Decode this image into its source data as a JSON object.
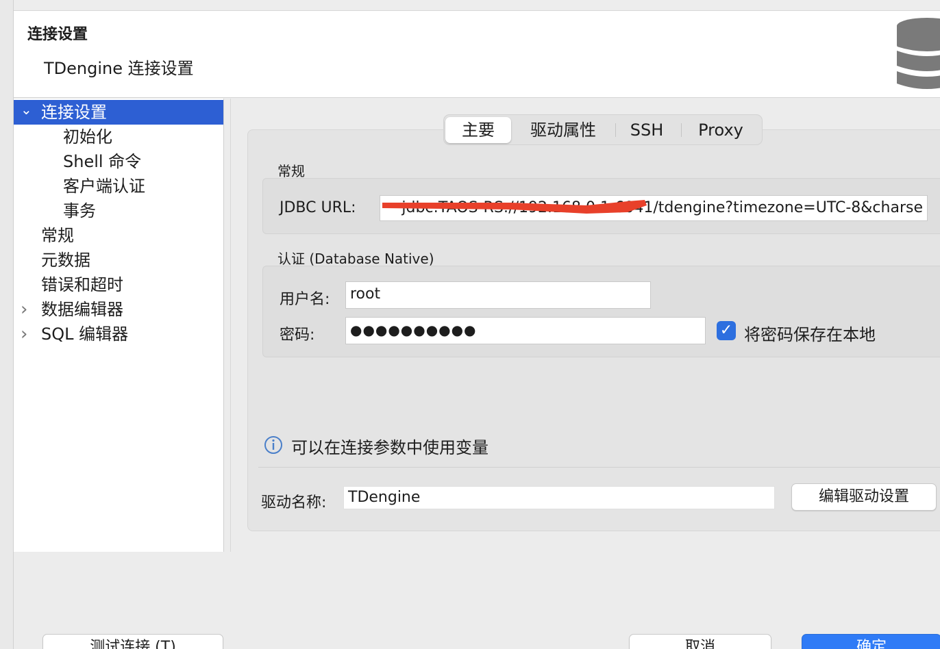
{
  "header": {
    "title": "连接设置",
    "subtitle": "TDengine 连接设置",
    "icon": "database-icon"
  },
  "nav": {
    "items": [
      {
        "label": "连接设置",
        "selected": true,
        "arrow": "⌄"
      },
      {
        "label": "初始化"
      },
      {
        "label": "Shell 命令"
      },
      {
        "label": "客户端认证"
      },
      {
        "label": "事务"
      },
      {
        "label": "常规"
      },
      {
        "label": "元数据"
      },
      {
        "label": "错误和超时"
      },
      {
        "label": "数据编辑器",
        "arrow": "›"
      },
      {
        "label": "SQL 编辑器",
        "arrow": "›"
      }
    ]
  },
  "tabs": [
    {
      "label": "主要",
      "active": true
    },
    {
      "label": "驱动属性"
    },
    {
      "label": "SSH"
    },
    {
      "label": "Proxy"
    }
  ],
  "general": {
    "label": "常规",
    "jdbc_label": "JDBC URL:",
    "jdbc_value": "jdbc:TAOS-RS://192.168.0.1:6041/tdengine?timezone=UTC-8&charse"
  },
  "auth": {
    "label": "认证 (Database Native)",
    "username_label": "用户名:",
    "username_value": "root",
    "password_label": "密码:",
    "password_value": "●●●●●●●●●●",
    "save_password_label": "将密码保存在本地",
    "save_password_checked": true
  },
  "info": {
    "text": "可以在连接参数中使用变量"
  },
  "driver": {
    "label": "驱动名称:",
    "value": "TDengine",
    "edit_button": "编辑驱动设置"
  },
  "footer": {
    "test_button": "测试连接 (T)",
    "cancel_button": "取消",
    "ok_button": "确定"
  },
  "colors": {
    "accent": "#2d5fd3",
    "primary_button": "#2f7bf6",
    "redaction": "#e8402a"
  }
}
